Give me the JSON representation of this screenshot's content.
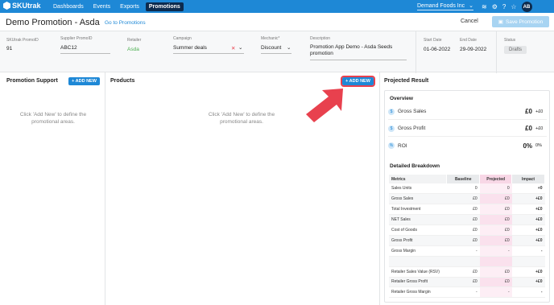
{
  "nav": {
    "brand": "SKUtrak",
    "links": [
      "Dashboards",
      "Events",
      "Exports",
      "Promotions"
    ],
    "company": "Demand Foods Inc",
    "avatar": "AB"
  },
  "header": {
    "title": "Demo Promotion - Asda",
    "goto_label": "Go to Promotions",
    "cancel_label": "Cancel",
    "save_label": "Save Promotion"
  },
  "fields": {
    "promo_id_label": "SKUtrak PromoID",
    "promo_id": "91",
    "supplier_label": "Supplier PromoID",
    "supplier_value": "ABC12",
    "retailer_label": "Retailer",
    "retailer_value": "Asda",
    "campaign_label": "Campaign",
    "campaign_value": "Summer deals",
    "mechanic_label": "Mechanic*",
    "mechanic_value": "Discount",
    "description_label": "Description",
    "description_value": "Promotion App Demo - Asda Seeds promotion",
    "start_label": "Start Date",
    "start_value": "01-06-2022",
    "end_label": "End Date",
    "end_value": "29-09-2022",
    "status_label": "Status",
    "status_value": "Drafts"
  },
  "promotion_support": {
    "title": "Promotion Support",
    "add_label": "+ ADD NEW",
    "empty_text": "Click 'Add New' to define the promotional areas."
  },
  "products": {
    "title": "Products",
    "add_label": "+ ADD NEW",
    "empty_text": "Click 'Add New' to define the promotional areas."
  },
  "projected": {
    "title": "Projected Result",
    "overview_title": "Overview",
    "overview": [
      {
        "label": "Gross Sales",
        "value": "£0",
        "delta": "+£0",
        "icon": "$"
      },
      {
        "label": "Gross Profit",
        "value": "£0",
        "delta": "+£0",
        "icon": "$"
      },
      {
        "label": "ROI",
        "value": "0%",
        "delta": "0%",
        "icon": "%"
      }
    ],
    "breakdown_title": "Detailed Breakdown",
    "columns": [
      "Metrics",
      "Baseline",
      "Projected",
      "Impact"
    ],
    "rows": [
      [
        "Sales Units",
        "0",
        "0",
        "+0"
      ],
      [
        "Gross Sales",
        "£0",
        "£0",
        "+£0"
      ],
      [
        "Total Investment",
        "£0",
        "£0",
        "+£0"
      ],
      [
        "NET Sales",
        "£0",
        "£0",
        "+£0"
      ],
      [
        "Cost of Goods",
        "£0",
        "£0",
        "+£0"
      ],
      [
        "Gross Profit",
        "£0",
        "£0",
        "+£0"
      ],
      [
        "Gross Margin",
        "-",
        "-",
        "-"
      ],
      [
        "",
        "",
        "",
        ""
      ],
      [
        "Retailer Sales Value (RSV)",
        "£0",
        "£0",
        "+£0"
      ],
      [
        "Retailer Gross Profit",
        "£0",
        "£0",
        "+£0"
      ],
      [
        "Retailer Gross Margin",
        "-",
        "-",
        "-"
      ]
    ]
  },
  "colors": {
    "brand": "#1e88d6",
    "active_nav": "#0d2b4e",
    "highlight": "#e8414e",
    "retailer": "#4caf50"
  }
}
